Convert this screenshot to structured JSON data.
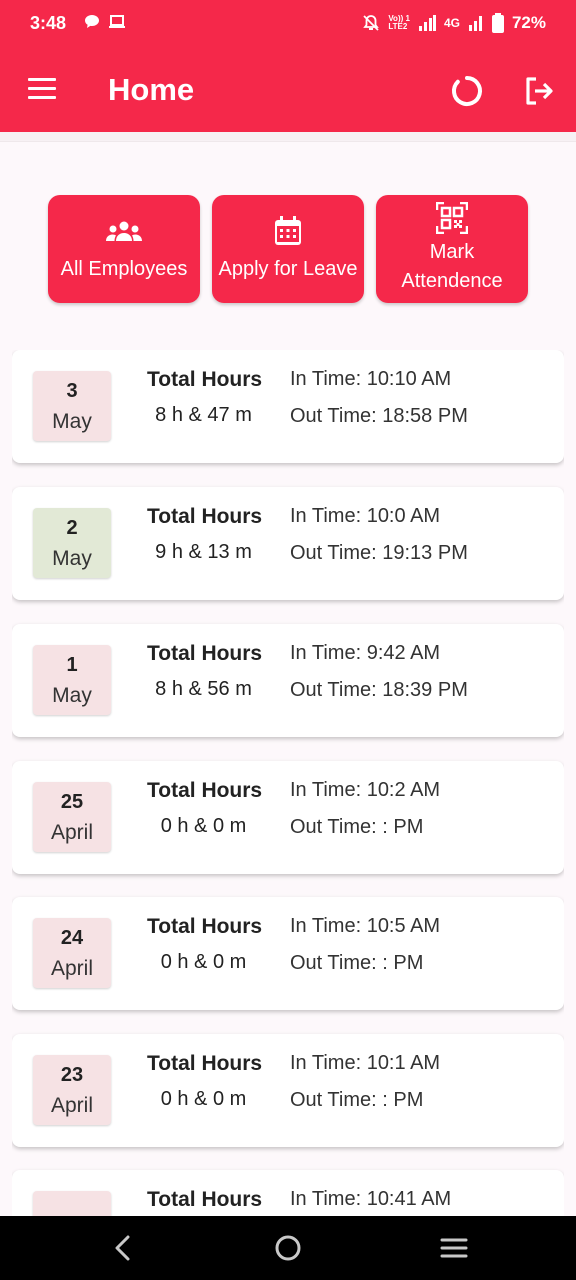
{
  "status_bar": {
    "time": "3:48",
    "lte_line1": "Vo)) 1",
    "lte_line2": "LTE2",
    "network": "4G",
    "battery": "72%"
  },
  "app_bar": {
    "title": "Home"
  },
  "actions": [
    {
      "label": "All Employees",
      "icon": "people-icon"
    },
    {
      "label": "Apply for Leave",
      "icon": "calendar-icon"
    },
    {
      "label_line1": "Mark",
      "label_line2": "Attendence",
      "icon": "qr-code-icon"
    }
  ],
  "attendance": [
    {
      "day": "3",
      "month": "May",
      "hours_title": "Total Hours",
      "hours": "8 h & 47 m",
      "in_time": "In Time: 10:10 AM",
      "out_time": "Out Time: 18:58 PM"
    },
    {
      "day": "2",
      "month": "May",
      "hours_title": "Total Hours",
      "hours": "9 h & 13 m",
      "in_time": "In Time: 10:0 AM",
      "out_time": "Out Time: 19:13 PM"
    },
    {
      "day": "1",
      "month": "May",
      "hours_title": "Total Hours",
      "hours": "8 h & 56 m",
      "in_time": "In Time: 9:42 AM",
      "out_time": "Out Time: 18:39 PM"
    },
    {
      "day": "25",
      "month": "April",
      "hours_title": "Total Hours",
      "hours": "0 h & 0 m",
      "in_time": "In Time: 10:2 AM",
      "out_time": "Out Time: : PM"
    },
    {
      "day": "24",
      "month": "April",
      "hours_title": "Total Hours",
      "hours": "0 h & 0 m",
      "in_time": "In Time: 10:5 AM",
      "out_time": "Out Time: : PM"
    },
    {
      "day": "23",
      "month": "April",
      "hours_title": "Total Hours",
      "hours": "0 h & 0 m",
      "in_time": "In Time: 10:1 AM",
      "out_time": "Out Time: : PM"
    },
    {
      "day": "",
      "month": "",
      "hours_title": "Total Hours",
      "hours": "",
      "in_time": "In Time: 10:41 AM",
      "out_time": ""
    }
  ],
  "colors": {
    "accent": "#f5284a",
    "date_default": "#f6e2e4",
    "date_highlight": "#e2e9d6"
  }
}
